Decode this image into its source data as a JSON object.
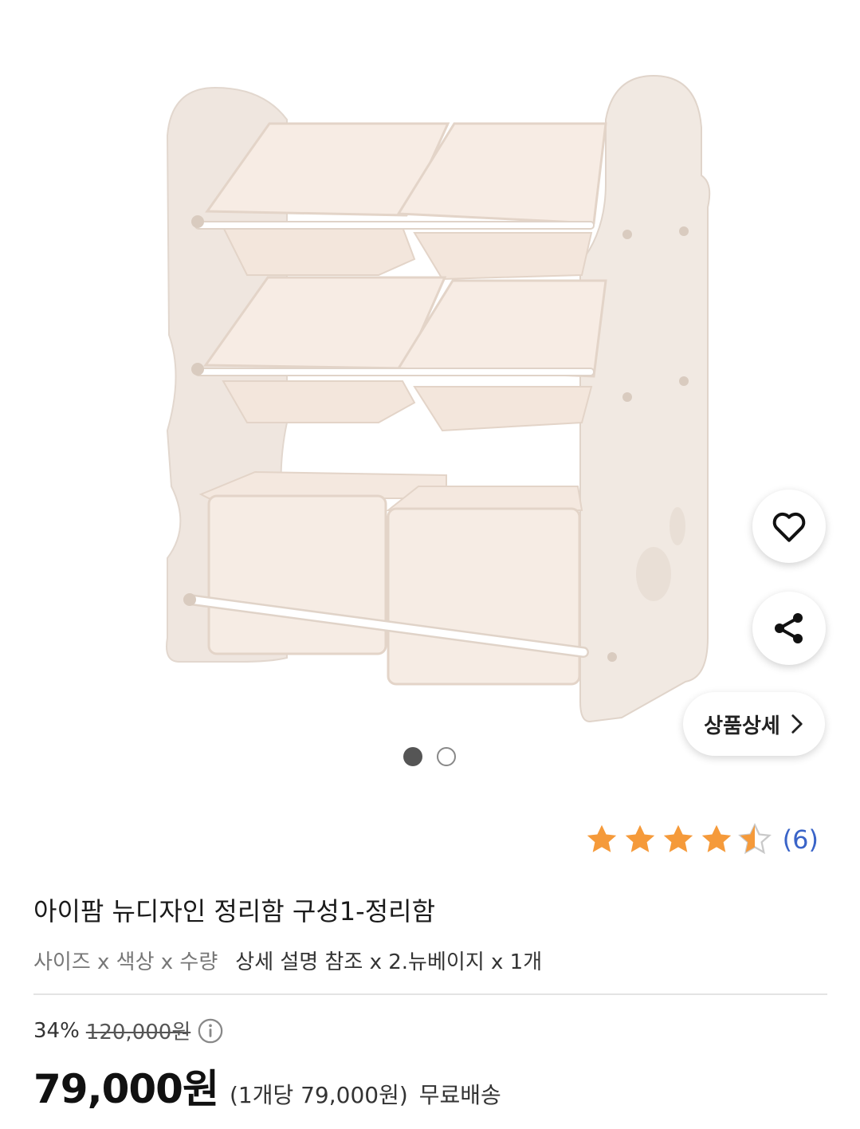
{
  "gallery": {
    "image_alt": "product-image-toy-organizer",
    "dot_count": 2,
    "active_index": 0
  },
  "actions": {
    "wishlist_icon": "heart-icon",
    "share_icon": "share-icon",
    "detail_label": "상품상세",
    "detail_icon": "chevron-right-icon"
  },
  "rating": {
    "value": 4.5,
    "max": 5,
    "count_text": "(6)",
    "star_color": "#f59a3a"
  },
  "product": {
    "title": "아이팜 뉴디자인 정리함 구성1-정리함",
    "option_label": "사이즈 x 색상 x 수량",
    "option_value": "상세 설명 참조 x 2.뉴베이지 x 1개"
  },
  "pricing": {
    "discount_pct": "34%",
    "original_price": "120,000원",
    "info_icon": "info-icon",
    "price": "79,000원",
    "unit_price": "(1개당 79,000원)",
    "shipping": "무료배송"
  }
}
